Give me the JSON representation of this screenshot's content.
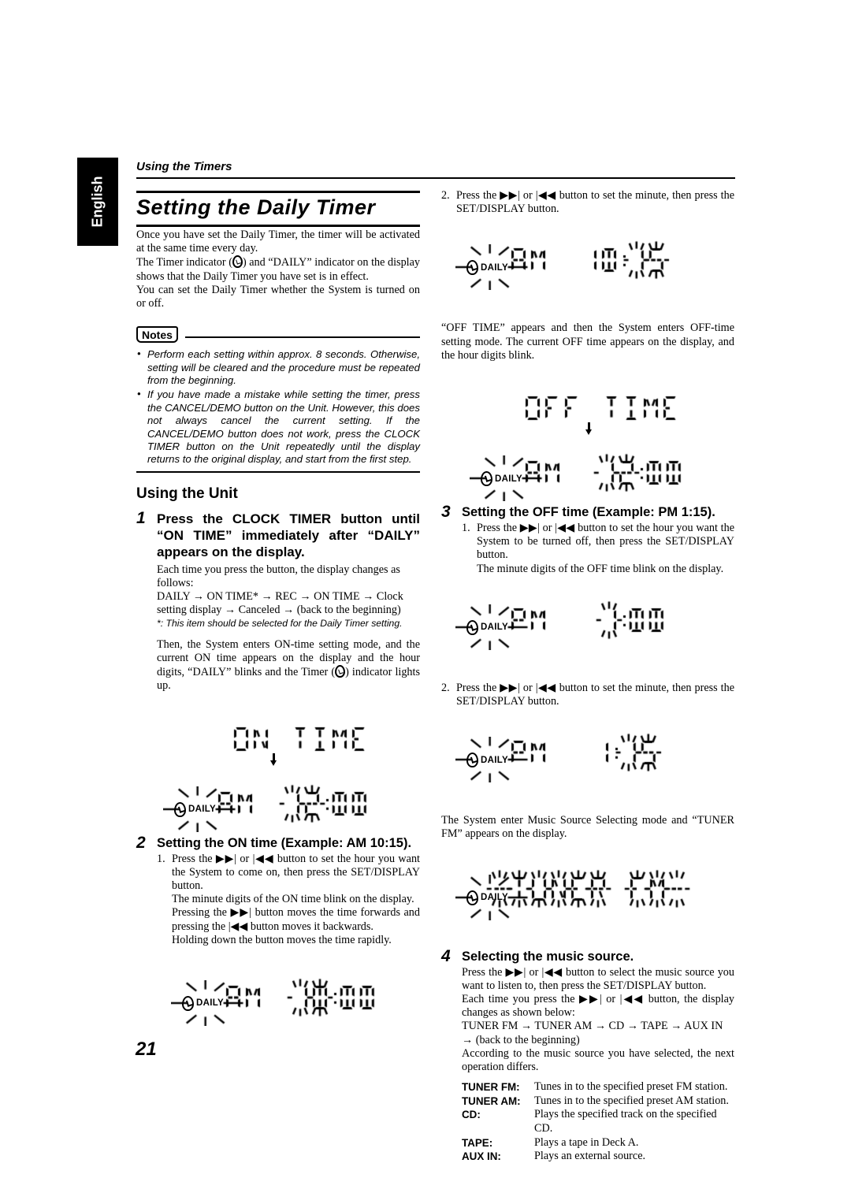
{
  "language_tab": "English",
  "running_head": "Using the Timers",
  "chapter_title": "Setting the Daily Timer",
  "page_number": "21",
  "intro": {
    "p1": "Once you have set the Daily Timer, the timer will be activated at the same time every day.",
    "p2_a": "The Timer indicator (",
    "p2_b": ") and “DAILY” indicator on the display shows that the Daily Timer you have set is in effect.",
    "p3": "You can set the Daily Timer whether the System is turned on or off."
  },
  "notes": {
    "badge": "Notes",
    "items": [
      "Perform each setting within approx. 8 seconds. Otherwise, setting will be cleared and the procedure must be repeated from the beginning.",
      "If you have made a mistake while setting the timer, press the CANCEL/DEMO button on the Unit. However, this does not always cancel the current setting. If the CANCEL/DEMO button does not work, press the CLOCK TIMER button on the Unit repeatedly until the display returns to the original display, and start from the first step."
    ]
  },
  "using_the_unit": {
    "title": "Using the Unit",
    "step1": {
      "number": "1",
      "heading": "Press the CLOCK TIMER button until “ON TIME” immediately after “DAILY” appears on the display.",
      "body1": "Each time you press the button, the display changes as follows:",
      "sequence": "DAILY → ON TIME* → REC → ON TIME → Clock setting display → Canceled → (back to the beginning)",
      "footnote": "*: This item should be selected for the Daily Timer setting.",
      "body2_a": "Then, the System enters ON-time setting mode, and the current ON time appears on the display and the hour digits, “DAILY” blinks and the Timer (",
      "body2_b": ") indicator lights up."
    },
    "lcd_on_time": {
      "line1": "ON TIME",
      "meridiem": "AM",
      "time": "12:00",
      "daily_label": "DAILY",
      "blink_target": "hour",
      "arrow": true
    },
    "step2": {
      "number": "2",
      "heading": "Setting the ON time (Example: AM 10:15).",
      "sub1_number": "1.",
      "sub1": "Press the ▶▶| or |◀◀ button to set the hour you want the System to come on, then press the SET/DISPLAY button.",
      "sub1_line2": "The minute digits of the ON time blink on the display.",
      "sub1_line3": "Pressing the ▶▶| button moves the time forwards and pressing the |◀◀ button moves it backwards.",
      "sub1_line4": "Holding down the button moves the time rapidly."
    },
    "lcd_on_hour_set": {
      "meridiem": "AM",
      "time": "10:00",
      "daily_label": "DAILY",
      "blink_target": "hour"
    }
  },
  "right_column": {
    "step2_sub2_number": "2.",
    "step2_sub2": "Press the ▶▶| or |◀◀ button to set the minute, then press the SET/DISPLAY button.",
    "lcd_on_10_15": {
      "meridiem": "AM",
      "time": "10:15",
      "daily_label": "DAILY",
      "blink_target": "minute"
    },
    "after_on_text": "“OFF TIME” appears and then the System enters OFF-time setting mode. The current OFF time appears on the display, and the hour digits blink.",
    "lcd_off_time": {
      "line1": "OFF TIME",
      "meridiem": "AM",
      "time": "12:00",
      "daily_label": "DAILY",
      "blink_target": "hour",
      "arrow": true
    },
    "step3": {
      "number": "3",
      "heading": "Setting the OFF time (Example: PM 1:15).",
      "sub1_number": "1.",
      "sub1": "Press the ▶▶| or |◀◀ button to set the hour you want the System to be turned off, then press the SET/DISPLAY button.",
      "sub1_line2": "The minute digits of the OFF time blink on the display."
    },
    "lcd_off_hour_set": {
      "meridiem": "PM",
      "time": "1:00",
      "daily_label": "DAILY",
      "blink_target": "hour"
    },
    "step3_sub2_number": "2.",
    "step3_sub2": "Press the ▶▶| or |◀◀ button to set the minute, then press the SET/DISPLAY button.",
    "lcd_off_1_15": {
      "meridiem": "PM",
      "time": "1:15",
      "daily_label": "DAILY",
      "blink_target": "minute"
    },
    "after_off_text": "The System enter Music Source Selecting mode and “TUNER FM” appears on the display.",
    "lcd_tuner": {
      "text": "-TUNER FM-",
      "daily_label": "DAILY",
      "blink_target": "all"
    },
    "step4": {
      "number": "4",
      "heading": "Selecting the music source.",
      "body1": "Press the ▶▶| or |◀◀ button to select the music source you want to listen to, then press the SET/DISPLAY button.",
      "body2": "Each time you press the ▶▶| or |◀◀ button, the display changes as shown below:",
      "sequence": "TUNER FM → TUNER AM → CD → TAPE → AUX IN → (back to the beginning)",
      "body3": "According to the music source you have selected, the next operation differs."
    },
    "source_table": [
      {
        "key": "TUNER FM:",
        "value": "Tunes in to the specified preset FM station."
      },
      {
        "key": "TUNER AM:",
        "value": "Tunes in to the specified preset AM station."
      },
      {
        "key": "CD:",
        "value": "Plays the specified track on the specified CD."
      },
      {
        "key": "TAPE:",
        "value": "Plays a tape in Deck A."
      },
      {
        "key": "AUX IN:",
        "value": "Plays an external source."
      }
    ]
  }
}
